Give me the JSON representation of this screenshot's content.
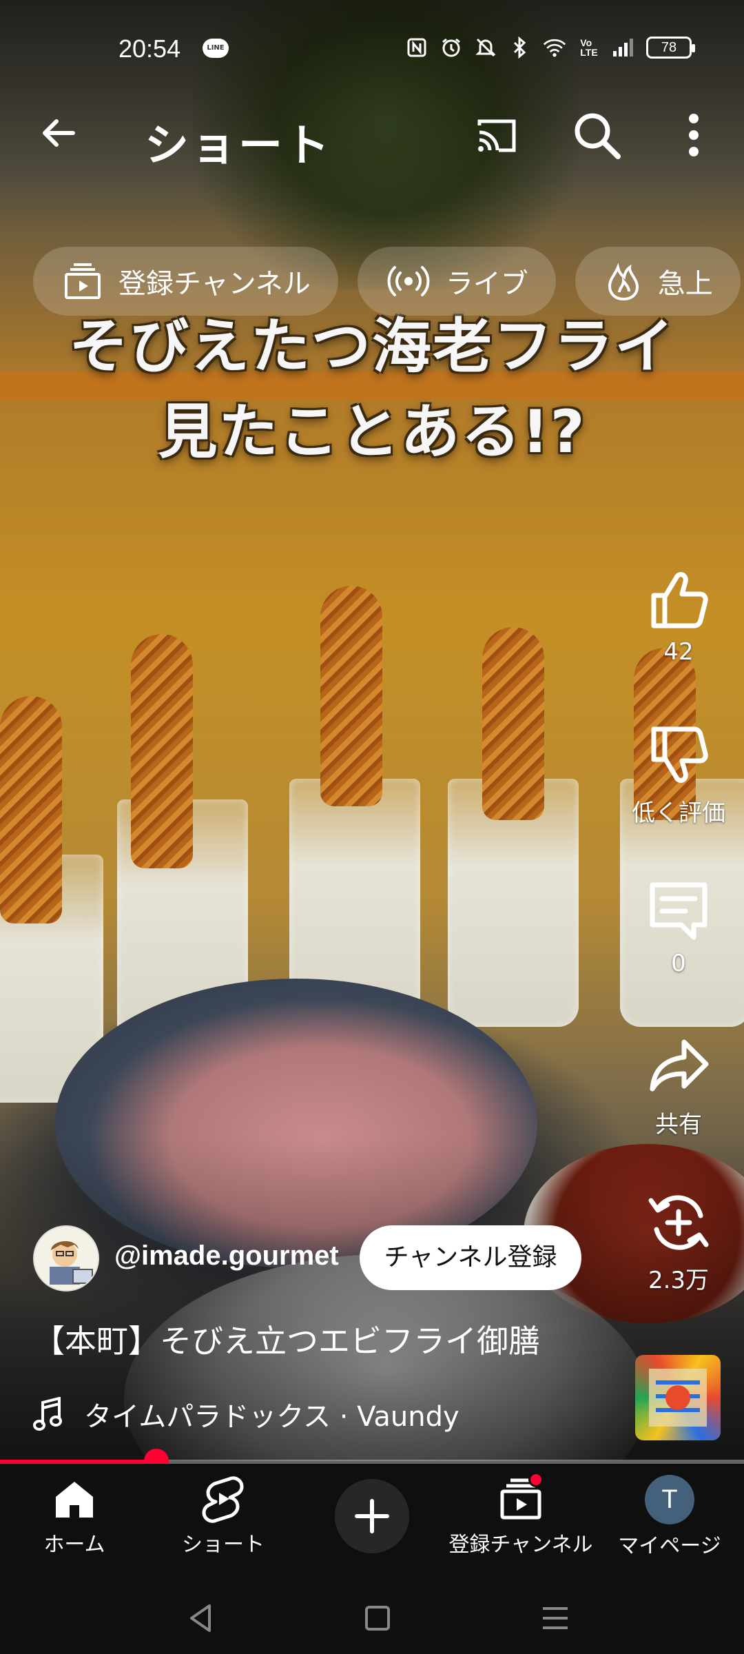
{
  "status": {
    "time": "20:54",
    "line_badge": "LINE",
    "battery": "78",
    "icons": [
      "nfc-icon",
      "alarm-icon",
      "mute-icon",
      "bluetooth-icon",
      "wifi-icon",
      "volte-icon",
      "signal-icon",
      "battery-icon"
    ]
  },
  "header": {
    "title": "ショート",
    "back_icon": "arrow-left-icon",
    "cast_icon": "cast-icon",
    "search_icon": "search-icon",
    "more_icon": "more-vert-icon"
  },
  "chips": [
    {
      "label": "登録チャンネル",
      "icon": "subscriptions-icon"
    },
    {
      "label": "ライブ",
      "icon": "live-icon"
    },
    {
      "label": "急上",
      "icon": "trending-icon"
    }
  ],
  "video": {
    "caption_line1": "そびえたつ海老フライ",
    "caption_line2": "見たことある!?",
    "progress_fraction": 0.21
  },
  "actions": {
    "like_count": "42",
    "dislike_label": "低く評価",
    "comment_count": "0",
    "share_label": "共有",
    "remix_count": "2.3万"
  },
  "channel": {
    "handle": "@imade.gourmet",
    "subscribe_label": "チャンネル登録"
  },
  "title": "【本町】そびえ立つエビフライ御膳",
  "music": {
    "text": "タイムパラドックス · Vaundy",
    "icon": "music-note-icon"
  },
  "bottom_nav": [
    {
      "label": "ホーム",
      "icon": "home-icon"
    },
    {
      "label": "ショート",
      "icon": "shorts-icon"
    },
    {
      "label": "",
      "icon": "plus-icon"
    },
    {
      "label": "登録チャンネル",
      "icon": "subscriptions-icon"
    },
    {
      "label": "マイページ",
      "icon": "avatar-icon",
      "avatar_letter": "T"
    }
  ],
  "colors": {
    "accent": "#ff0033",
    "nav_bg": "#0f0f0f",
    "my_avatar_bg": "#45607a"
  }
}
